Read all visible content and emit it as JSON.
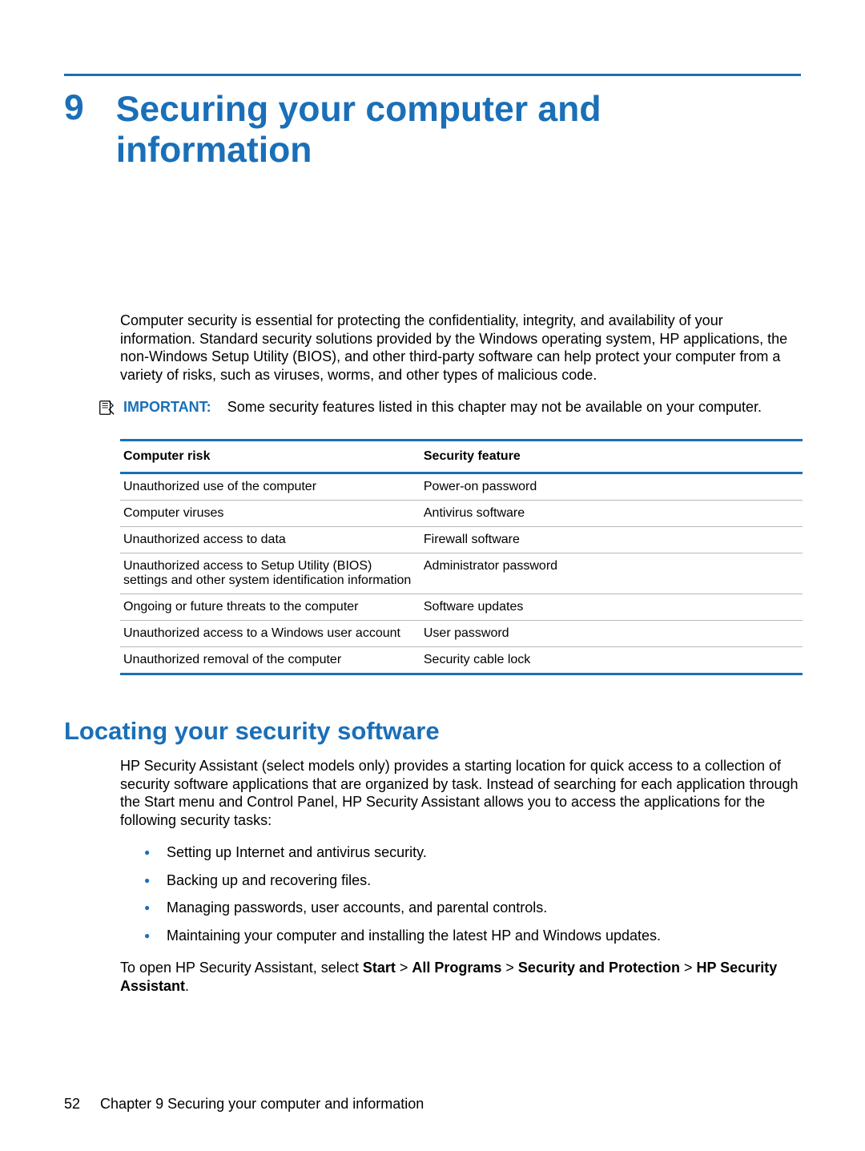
{
  "chapter": {
    "number": "9",
    "title": "Securing your computer and information"
  },
  "intro_paragraph": "Computer security is essential for protecting the confidentiality, integrity, and availability of your information. Standard security solutions provided by the Windows operating system, HP applications, the non-Windows Setup Utility (BIOS), and other third-party software can help protect your computer from a variety of risks, such as viruses, worms, and other types of malicious code.",
  "important_note": {
    "label": "IMPORTANT:",
    "text": "Some security features listed in this chapter may not be available on your computer."
  },
  "table": {
    "headers": {
      "risk": "Computer risk",
      "feature": "Security feature"
    },
    "rows": [
      {
        "risk": "Unauthorized use of the computer",
        "feature": "Power-on password"
      },
      {
        "risk": "Computer viruses",
        "feature": "Antivirus software"
      },
      {
        "risk": "Unauthorized access to data",
        "feature": "Firewall software"
      },
      {
        "risk": "Unauthorized access to Setup Utility (BIOS) settings and other system identification information",
        "feature": "Administrator password"
      },
      {
        "risk": "Ongoing or future threats to the computer",
        "feature": "Software updates"
      },
      {
        "risk": "Unauthorized access to a Windows user account",
        "feature": "User password"
      },
      {
        "risk": "Unauthorized removal of the computer",
        "feature": "Security cable lock"
      }
    ]
  },
  "section": {
    "heading": "Locating your security software",
    "paragraph": "HP Security Assistant (select models only) provides a starting location for quick access to a collection of security software applications that are organized by task. Instead of searching for each application through the Start menu and Control Panel, HP Security Assistant allows you to access the applications for the following security tasks:",
    "bullets": [
      "Setting up Internet and antivirus security.",
      "Backing up and recovering files.",
      "Managing passwords, user accounts, and parental controls.",
      "Maintaining your computer and installing the latest HP and Windows updates."
    ],
    "open_path": {
      "prefix": "To open HP Security Assistant, select ",
      "segments": [
        "Start",
        "All Programs",
        "Security and Protection",
        "HP Security Assistant"
      ],
      "separator": " > ",
      "suffix": "."
    }
  },
  "footer": {
    "page_number": "52",
    "chapter_label": "Chapter 9   Securing your computer and information"
  }
}
